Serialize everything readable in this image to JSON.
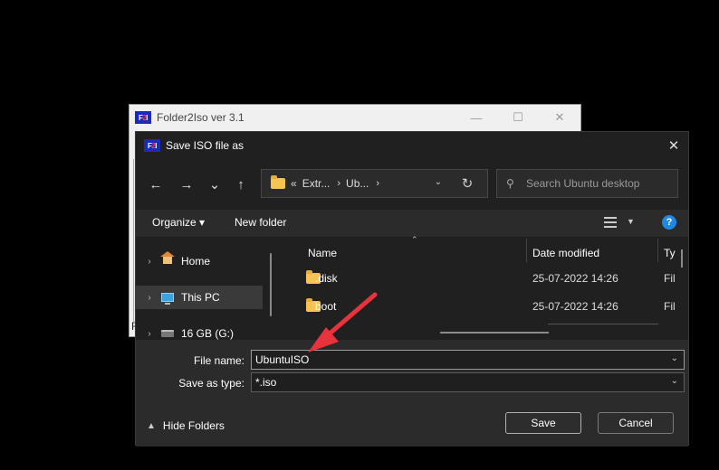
{
  "background_window": {
    "title": "Folder2Iso ver 3.1",
    "logo_left": "F",
    "logo_mid": "2",
    "logo_right": "I",
    "minimize": "—",
    "maximize": "☐",
    "close": "✕",
    "partial_label": "F"
  },
  "dialog": {
    "title": "Save ISO file as",
    "close": "✕",
    "nav": {
      "back": "←",
      "forward": "→",
      "recent": "⌄",
      "up": "↑",
      "breadcrumbs": [
        "Extr...",
        "Ub..."
      ],
      "overflow": "«",
      "separator": "›",
      "refresh": "↻",
      "search_placeholder": "Search Ubuntu desktop"
    },
    "toolbar": {
      "organize": "Organize ▾",
      "new_folder": "New folder",
      "help": "?"
    },
    "nav_pane": {
      "items": [
        {
          "label": "Home",
          "icon": "home-icon"
        },
        {
          "label": "This PC",
          "icon": "computer-icon",
          "selected": true
        },
        {
          "label": "16 GB (G:)",
          "icon": "drive-icon"
        }
      ]
    },
    "file_list": {
      "columns": {
        "name": "Name",
        "date": "Date modified",
        "type": "Ty"
      },
      "rows": [
        {
          "name": ".disk",
          "date": "25-07-2022 14:26",
          "type": "Fil"
        },
        {
          "name": "boot",
          "date": "25-07-2022 14:26",
          "type": "Fil"
        }
      ]
    },
    "bottom": {
      "file_name_label": "File name:",
      "file_name_value": "UbuntuISO",
      "save_type_label": "Save as type:",
      "save_type_value": "*.iso",
      "hide_folders": "Hide Folders",
      "save": "Save",
      "cancel": "Cancel"
    },
    "colors": {
      "annotation_arrow": "#e8323c",
      "accent": "#1e88e5",
      "folder": "#f6c453"
    }
  }
}
